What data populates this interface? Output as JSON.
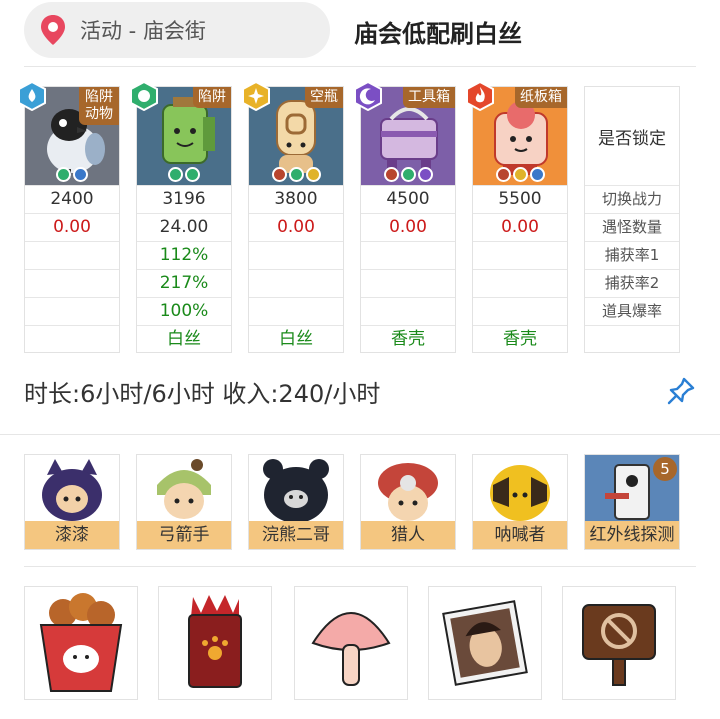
{
  "header": {
    "location": "活动 - 庙会街",
    "title": "庙会低配刷白丝"
  },
  "traps": [
    {
      "type": "陷阱\n动物",
      "element": "water",
      "mini_icons": [
        "green",
        "blue"
      ],
      "power": "2400",
      "monster_count": "0.00",
      "capture1": "",
      "capture2": "",
      "drop_rate": "",
      "drop": ""
    },
    {
      "type": "陷阱",
      "element": "leaf",
      "mini_icons": [
        "green",
        "green"
      ],
      "power": "3196",
      "monster_count": "24.00",
      "capture1": "112%",
      "capture2": "217%",
      "drop_rate": "100%",
      "drop": "白丝"
    },
    {
      "type": "空瓶",
      "element": "light",
      "mini_icons": [
        "red",
        "green",
        "yellow"
      ],
      "power": "3800",
      "monster_count": "0.00",
      "capture1": "",
      "capture2": "",
      "drop_rate": "",
      "drop": "白丝"
    },
    {
      "type": "工具箱",
      "element": "dark",
      "mini_icons": [
        "red",
        "green",
        "purple"
      ],
      "power": "4500",
      "monster_count": "0.00",
      "capture1": "",
      "capture2": "",
      "drop_rate": "",
      "drop": "香壳"
    },
    {
      "type": "纸板箱",
      "element": "fire",
      "mini_icons": [
        "red",
        "yellow",
        "blue"
      ],
      "power": "5500",
      "monster_count": "0.00",
      "capture1": "",
      "capture2": "",
      "drop_rate": "",
      "drop": "香壳"
    }
  ],
  "lock_column": {
    "header": "是否锁定",
    "rows": [
      "切换战力",
      "遇怪数量",
      "捕获率1",
      "捕获率2",
      "道具爆率"
    ]
  },
  "summary": "时长:6小时/6小时 收入:240/小时",
  "hunters": [
    {
      "name": "漆漆"
    },
    {
      "name": "弓箭手"
    },
    {
      "name": "浣熊二哥"
    },
    {
      "name": "猎人"
    },
    {
      "name": "呐喊者"
    },
    {
      "name": "红外线探测",
      "count": "5"
    }
  ],
  "items": [
    "fried-chicken-bucket-icon",
    "red-paw-box-icon",
    "pink-mushroom-icon",
    "portrait-photo-icon",
    "no-sign-board-icon"
  ],
  "colors": {
    "badge_brown": "#a7672b",
    "label_orange": "#f4c680",
    "value_red": "#cc1a1a",
    "value_green": "#1a8a1a",
    "pin_blue": "#2a7fd4",
    "location_pin": "#e8475f"
  }
}
